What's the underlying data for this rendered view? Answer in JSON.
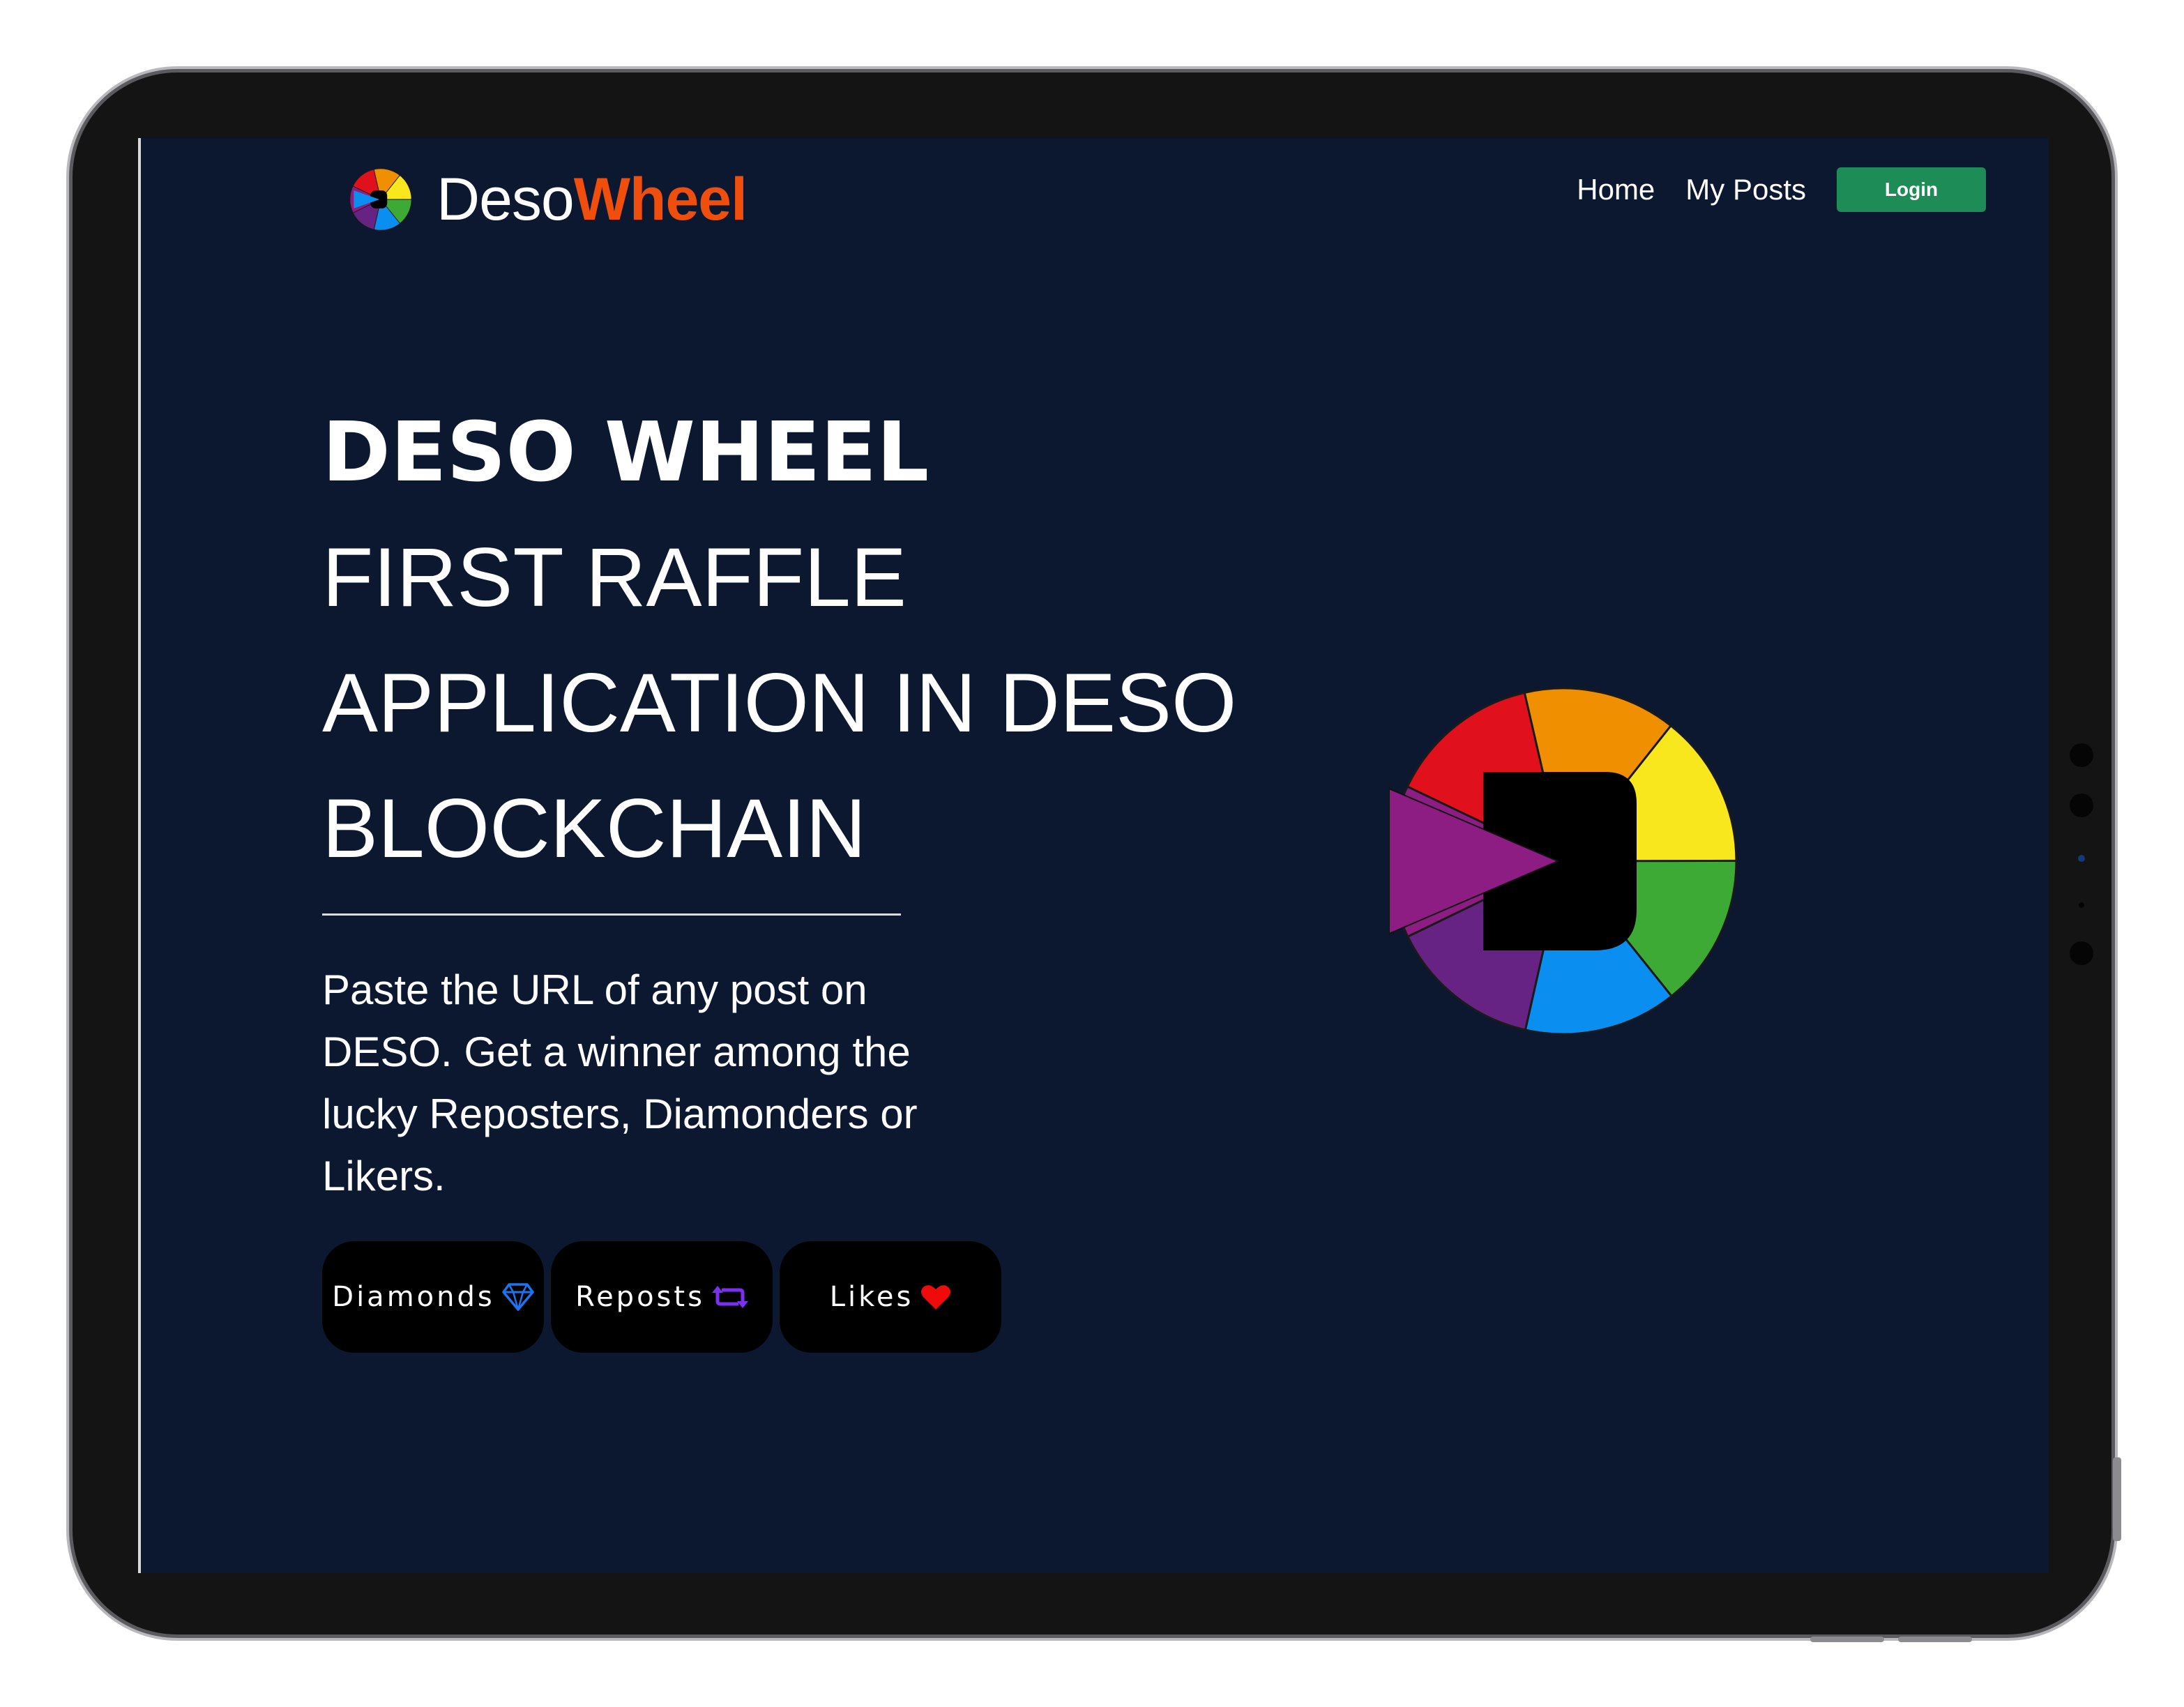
{
  "brand": {
    "name_part1": "Deso",
    "name_part2": "Wheel",
    "accent_color": "#f04e0c"
  },
  "nav": {
    "home": "Home",
    "my_posts": "My Posts",
    "login": "Login",
    "login_color": "#1e8c57"
  },
  "hero": {
    "title": "DESO WHEEL",
    "subtitle_line1": "FIRST RAFFLE",
    "subtitle_line2": "APPLICATION IN DESO",
    "subtitle_line3": "BLOCKCHAIN",
    "description": "Paste the URL of any post on DESO. Get a winner among the lucky Reposters, Diamonders or Likers."
  },
  "chips": {
    "diamonds": "Diamonds",
    "reposts": "Reposts",
    "likes": "Likes",
    "diamond_icon": "diamond-icon",
    "repost_icon": "repost-icon",
    "heart_icon": "heart-icon"
  },
  "wheel": {
    "segment_colors": [
      "#f09000",
      "#f8e71c",
      "#3caa34",
      "#0a8ff0",
      "#672383",
      "#8e1d83",
      "#e0101c"
    ]
  },
  "colors": {
    "page_background": "#0b1830"
  }
}
